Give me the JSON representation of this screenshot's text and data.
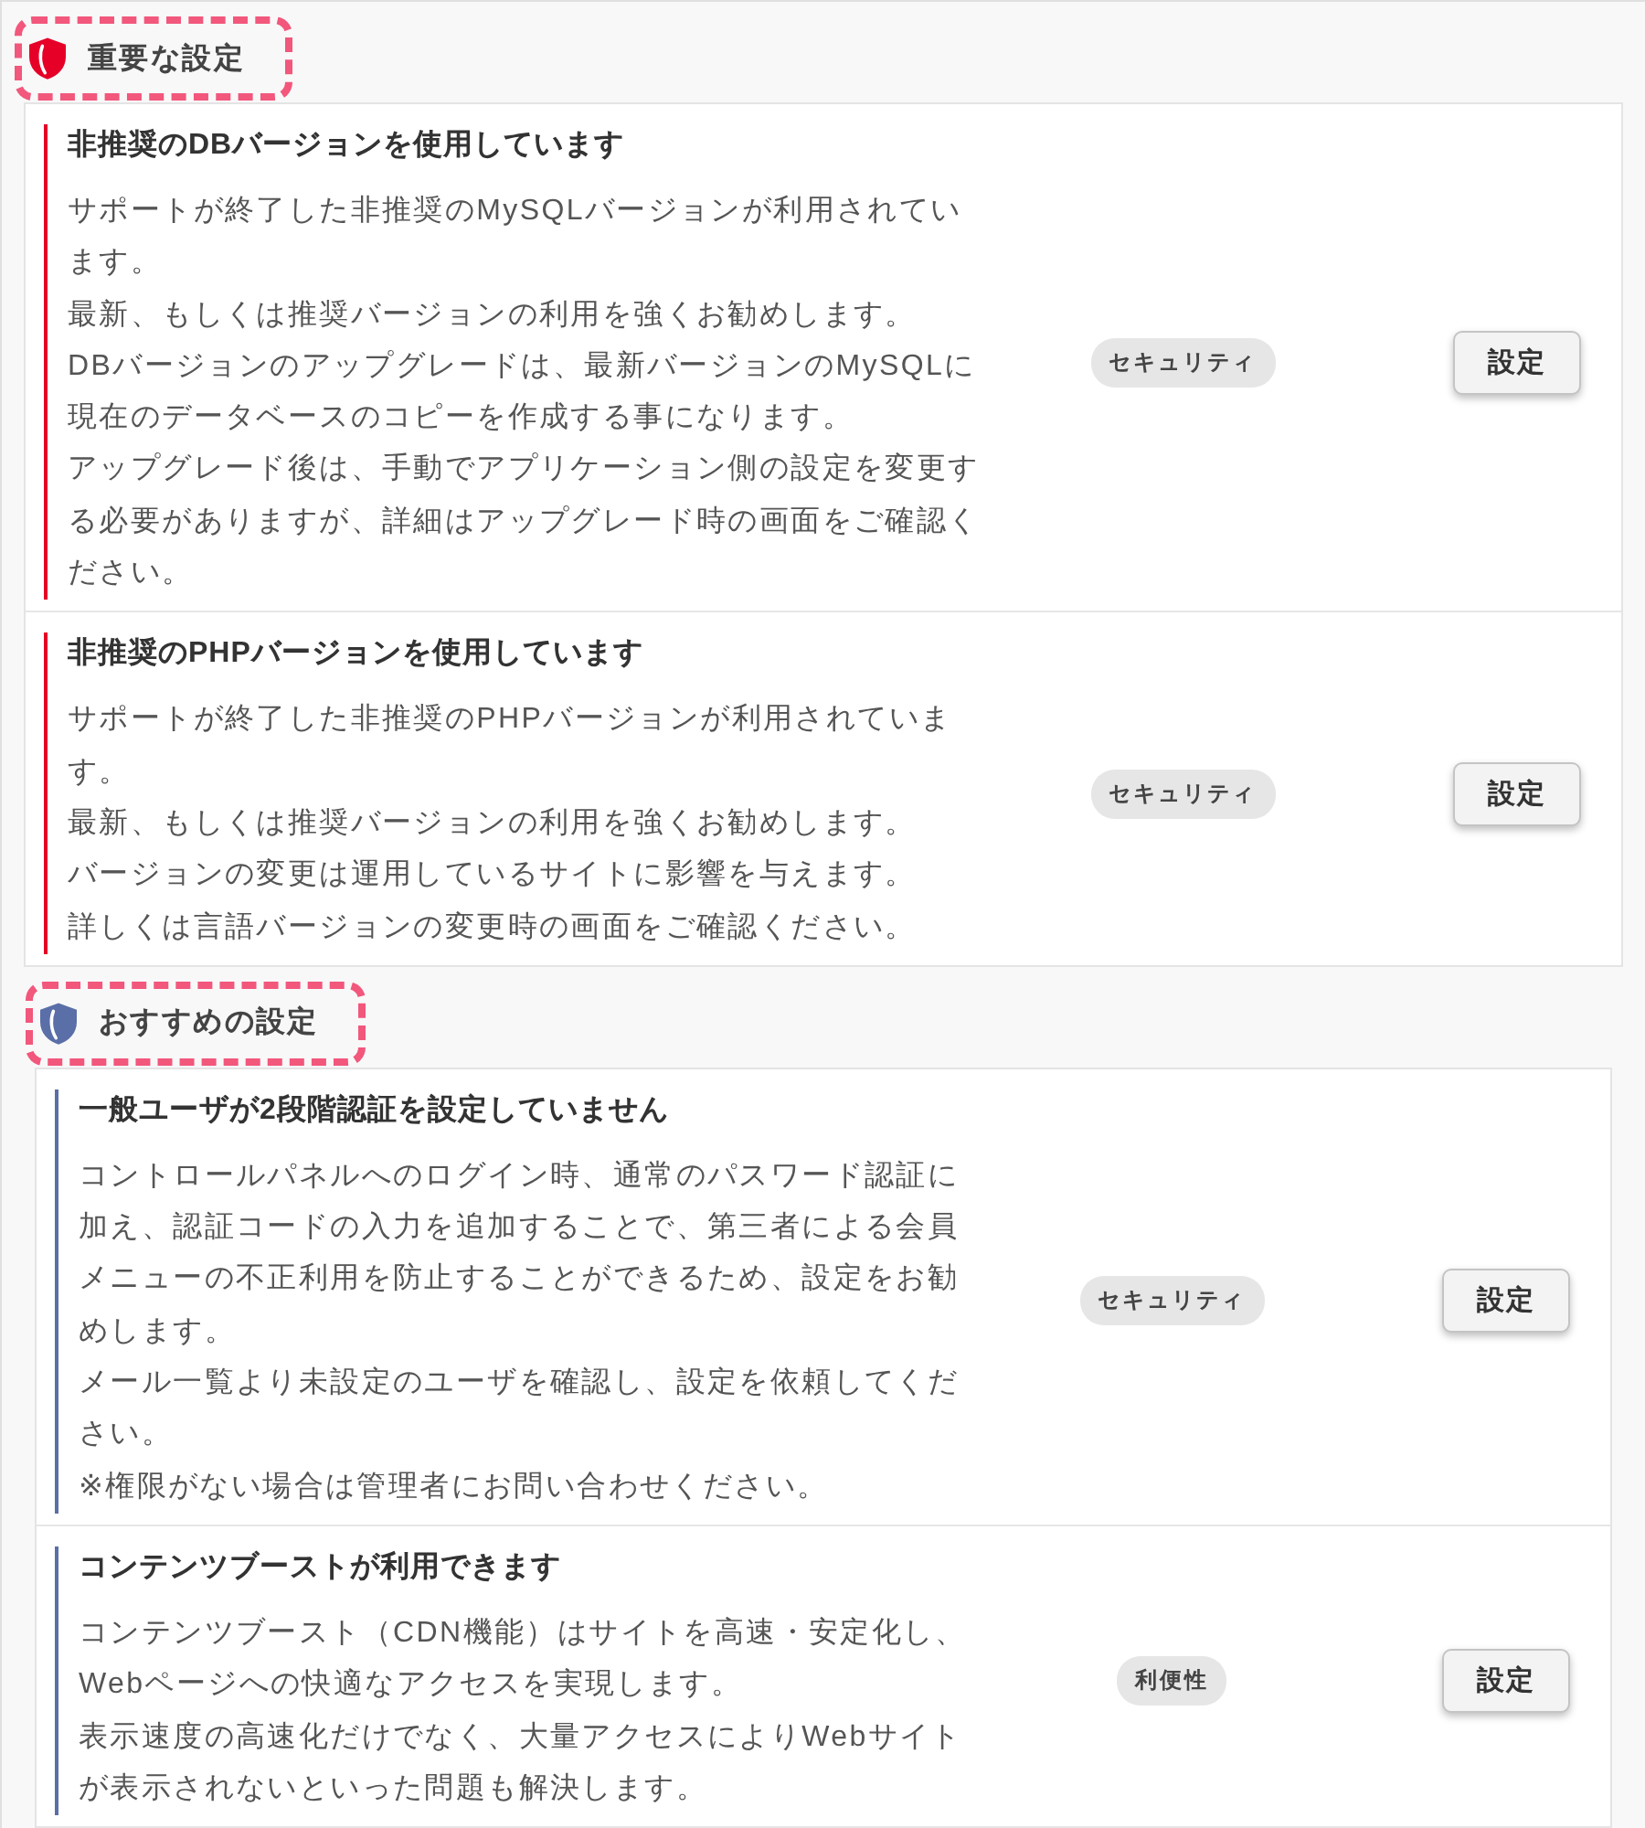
{
  "sections": [
    {
      "title": "重要な設定",
      "color": "#e60028",
      "items": [
        {
          "title": "非推奨のDBバージョンを使用しています",
          "description": [
            "サポートが終了した非推奨のMySQLバージョンが利用されています。",
            "最新、もしくは推奨バージョンの利用を強くお勧めします。",
            "DBバージョンのアップグレードは、最新バージョンのMySQLに現在のデータベースのコピーを作成する事になります。",
            "アップグレード後は、手動でアプリケーション側の設定を変更する必要がありますが、詳細はアップグレード時の画面をご確認ください。"
          ],
          "tag": "セキュリティ",
          "button": "設定"
        },
        {
          "title": "非推奨のPHPバージョンを使用しています",
          "description": [
            "サポートが終了した非推奨のPHPバージョンが利用されています。",
            "最新、もしくは推奨バージョンの利用を強くお勧めします。",
            "バージョンの変更は運用しているサイトに影響を与えます。",
            "詳しくは言語バージョンの変更時の画面をご確認ください。"
          ],
          "tag": "セキュリティ",
          "button": "設定"
        }
      ]
    },
    {
      "title": "おすすめの設定",
      "color": "#5a6ea8",
      "items": [
        {
          "title": "一般ユーザが2段階認証を設定していません",
          "description": [
            "コントロールパネルへのログイン時、通常のパスワード認証に加え、認証コードの入力を追加することで、第三者による会員メニューの不正利用を防止することができるため、設定をお勧めします。",
            "メール一覧より未設定のユーザを確認し、設定を依頼してください。",
            "※権限がない場合は管理者にお問い合わせください。"
          ],
          "tag": "セキュリティ",
          "button": "設定"
        },
        {
          "title": "コンテンツブーストが利用できます",
          "description": [
            "コンテンツブースト（CDN機能）はサイトを高速・安定化し、Webページへの快適なアクセスを実現します。",
            "表示速度の高速化だけでなく、大量アクセスによりWebサイトが表示されないといった問題も解決します。"
          ],
          "tag": "利便性",
          "button": "設定"
        }
      ]
    }
  ]
}
